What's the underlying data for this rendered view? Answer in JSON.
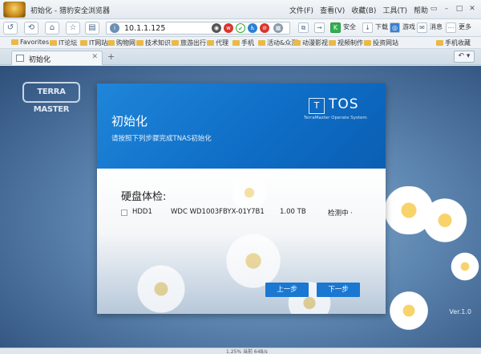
{
  "browser": {
    "title": "初始化 - 猎豹安全浏览器",
    "menu": [
      "文件(F)",
      "查看(V)",
      "收藏(B)",
      "工具(T)",
      "帮助"
    ],
    "url": "10.1.1.125",
    "right_items": {
      "security": "安全",
      "download": "下载",
      "game": "游戏",
      "messages": "消息",
      "more": "更多"
    },
    "bookmarks": [
      "Favorites",
      "IT论坛",
      "IT网站",
      "购物网",
      "技术知识",
      "旅游出行",
      "代理",
      "手机",
      "活动&众测",
      "动漫影视",
      "视频制作",
      "投资网站",
      "手机收藏"
    ],
    "tab": {
      "label": "初始化"
    },
    "status_text": "1.25% 当前 64B/s"
  },
  "page": {
    "logo": "TERRA MASTER",
    "version": "Ver.1.0"
  },
  "dialog": {
    "title": "初始化",
    "subtitle": "请按照下列步骤完成TNAS初始化",
    "brand": {
      "mark": "T",
      "name": "TOS",
      "tagline": "TerraMaster Operate System"
    },
    "section_title": "硬盘体检:",
    "disks": [
      {
        "slot": "HDD1",
        "model": "WDC WD1003FBYX-01Y7B1",
        "size": "1.00 TB",
        "status": "检测中 ·"
      }
    ],
    "prev_label": "上一步",
    "next_label": "下一步"
  }
}
